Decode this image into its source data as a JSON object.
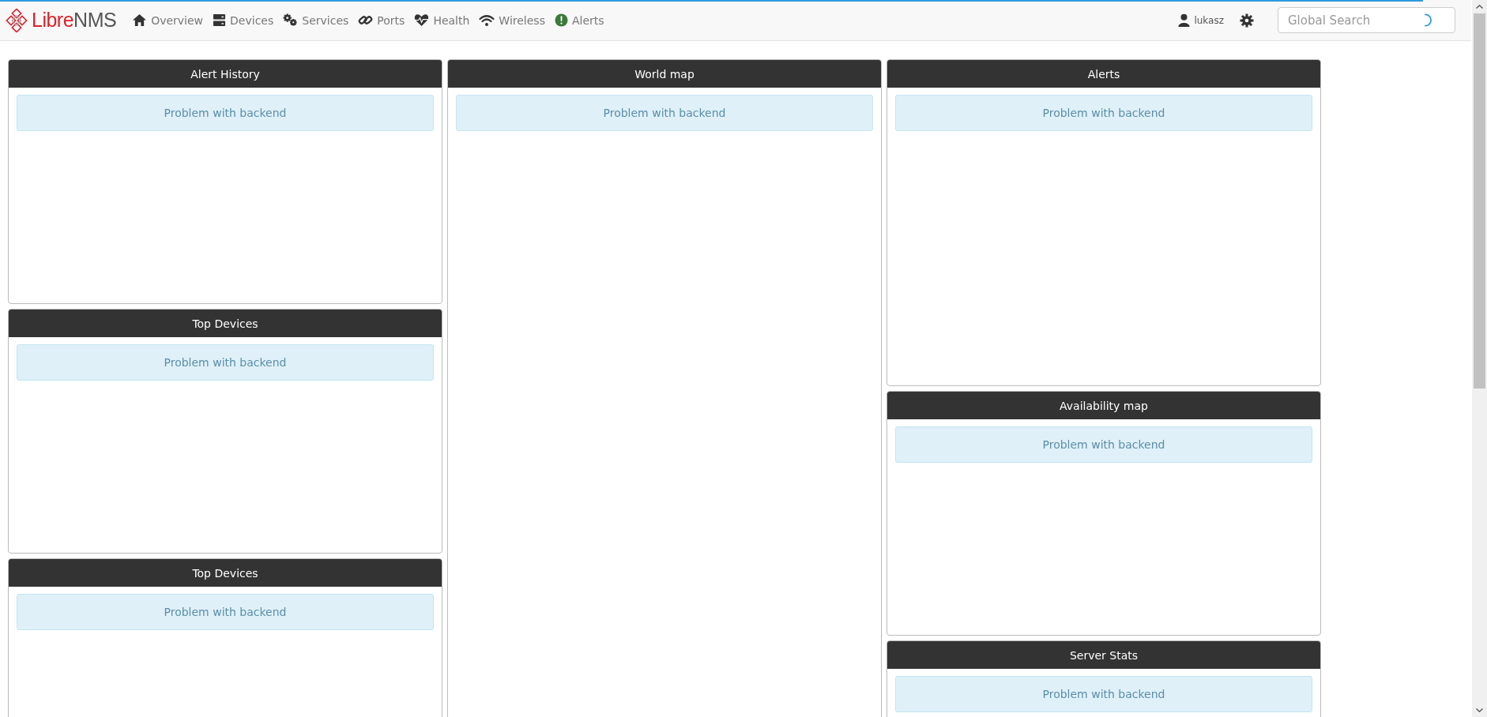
{
  "navbar": {
    "logo": {
      "part_1": "Libre",
      "part_2": "NMS"
    },
    "loading": {
      "level": 0.957
    },
    "items": [
      {
        "label": "Overview"
      },
      {
        "label": "Devices"
      },
      {
        "label": "Services"
      },
      {
        "label": "Ports"
      },
      {
        "label": "Health"
      },
      {
        "label": "Wireless"
      },
      {
        "label": "Alerts"
      }
    ],
    "user": "lukasz",
    "search": {
      "placeholder": "Global Search"
    }
  },
  "columns": [
    {
      "widgets": [
        {
          "title": "Alert History",
          "message": "Problem with backend"
        },
        {
          "title": "Top Devices",
          "message": "Problem with backend"
        },
        {
          "title": "Top Devices",
          "message": "Problem with backend"
        }
      ]
    },
    {
      "widgets": [
        {
          "title": "World map",
          "message": "Problem with backend"
        }
      ]
    },
    {
      "widgets": [
        {
          "title": "Alerts",
          "message": "Problem with backend"
        },
        {
          "title": "Availability map",
          "message": "Problem with backend"
        },
        {
          "title": "Server Stats",
          "message": "Problem with backend"
        }
      ]
    }
  ]
}
